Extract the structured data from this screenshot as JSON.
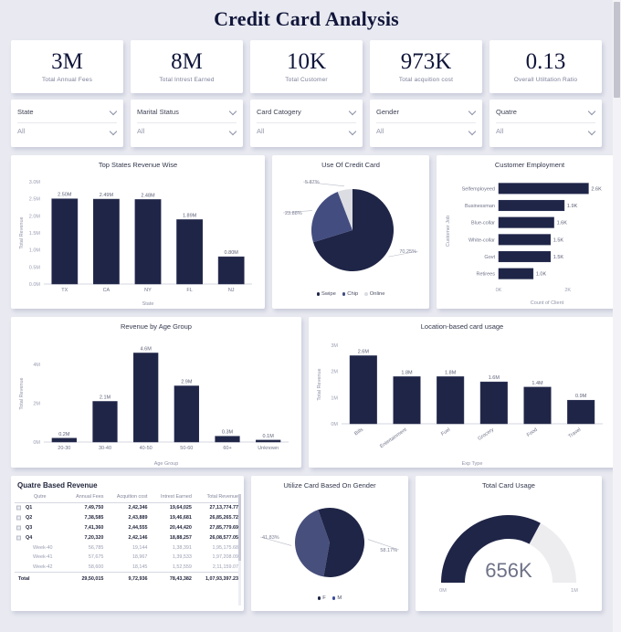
{
  "title": "Credit Card Analysis",
  "colors": {
    "navy": "#1f2547",
    "mid_blue": "#434d80",
    "light_grey": "#dcdde2",
    "page_bg": "#e9eaf1",
    "card_bg": "#ffffff"
  },
  "kpis": [
    {
      "value": "3M",
      "label": "Total Annual Fees"
    },
    {
      "value": "8M",
      "label": "Total Intrest Earned"
    },
    {
      "value": "10K",
      "label": "Total Customer"
    },
    {
      "value": "973K",
      "label": "Total acquition cost"
    },
    {
      "value": "0.13",
      "label": "Overall Utiltation Ratio"
    }
  ],
  "filters": [
    {
      "name": "State",
      "value": "All"
    },
    {
      "name": "Marital Status",
      "value": "All"
    },
    {
      "name": "Card Catogery",
      "value": "All"
    },
    {
      "name": "Gender",
      "value": "All"
    },
    {
      "name": "Quatre",
      "value": "All"
    }
  ],
  "chart_data": [
    {
      "type": "bar",
      "title": "Top States Revenue Wise",
      "xlabel": "State",
      "ylabel": "Total Revenue",
      "categories": [
        "TX",
        "CA",
        "NY",
        "FL",
        "NJ"
      ],
      "values": [
        2.5,
        2.49,
        2.48,
        1.89,
        0.8
      ],
      "labels": [
        "2.50M",
        "2.49M",
        "2.48M",
        "1.89M",
        "0.80M"
      ],
      "yticks": [
        "0.0M",
        "0.5M",
        "1.0M",
        "1.5M",
        "2.0M",
        "2.5M",
        "3.0M"
      ],
      "ylim": [
        0,
        3.0
      ],
      "grid": false
    },
    {
      "type": "pie",
      "title": "Use Of Credit Card",
      "categories": [
        "Swipe",
        "Chip",
        "Online"
      ],
      "values": [
        70.25,
        23.88,
        5.87
      ],
      "labels": [
        "70.25%",
        "23.88%",
        "5.87%"
      ],
      "colors": [
        "#1f2547",
        "#434d80",
        "#dcdde2"
      ],
      "legend": "bottom"
    },
    {
      "type": "bar",
      "orientation": "horizontal",
      "title": "Customer Employment",
      "xlabel": "Count of Client",
      "ylabel": "Customer Job",
      "categories": [
        "Selfemployeed",
        "Businessman",
        "Blue-collar",
        "White-collar",
        "Govt",
        "Retirees"
      ],
      "values": [
        2.6,
        1.9,
        1.6,
        1.5,
        1.5,
        1.0
      ],
      "labels": [
        "2.6K",
        "1.9K",
        "1.6K",
        "1.5K",
        "1.5K",
        "1.0K"
      ],
      "xticks": [
        "0K",
        "2K"
      ],
      "xlim": [
        0,
        2.8
      ],
      "grid": false
    },
    {
      "type": "bar",
      "title": "Revenue by Age Group",
      "xlabel": "Age Group",
      "ylabel": "Total Revenue",
      "categories": [
        "20-30",
        "30-40",
        "40-50",
        "50-60",
        "60+",
        "Unknown"
      ],
      "values": [
        0.2,
        2.1,
        4.6,
        2.9,
        0.3,
        0.1
      ],
      "labels": [
        "0.2M",
        "2.1M",
        "4.6M",
        "2.9M",
        "0.3M",
        "0.1M"
      ],
      "yticks": [
        "0M",
        "2M",
        "4M"
      ],
      "ylim": [
        0,
        5.0
      ],
      "grid": false
    },
    {
      "type": "bar",
      "title": "Location-based card usage",
      "xlabel": "Exp Type",
      "ylabel": "Total Revenue",
      "categories": [
        "Bills",
        "Entertainment",
        "Fuel",
        "Grocery",
        "Food",
        "Travel"
      ],
      "values": [
        2.6,
        1.8,
        1.8,
        1.6,
        1.4,
        0.9
      ],
      "labels": [
        "2.6M",
        "1.8M",
        "1.8M",
        "1.6M",
        "1.4M",
        "0.9M"
      ],
      "yticks": [
        "0M",
        "1M",
        "2M",
        "3M"
      ],
      "ylim": [
        0,
        3.0
      ],
      "grid": false
    },
    {
      "type": "pie",
      "title": "Utilize Card Based On Gender",
      "categories": [
        "F",
        "M"
      ],
      "values": [
        41.83,
        58.17
      ],
      "labels": [
        "41.83%",
        "58.17%"
      ],
      "colors": [
        "#474f7d",
        "#1f2547"
      ],
      "legend": "bottom"
    },
    {
      "type": "gauge",
      "title": "Total Card Usage",
      "value": 656000,
      "value_label": "656K",
      "min_label": "0M",
      "max_label": "1M",
      "ylim": [
        0,
        1000000
      ]
    }
  ],
  "table": {
    "title": "Quatre Based Revenue",
    "columns": [
      "Qutre",
      "Annual Fees",
      "Acquition cost",
      "Intrest Earned",
      "Total Revenue"
    ],
    "rows": [
      {
        "kind": "q",
        "cells": [
          "Q1",
          "7,49,750",
          "2,42,346",
          "19,64,025",
          "27,13,774.77"
        ]
      },
      {
        "kind": "q",
        "cells": [
          "Q2",
          "7,38,585",
          "2,43,889",
          "19,46,681",
          "26,85,265.72"
        ]
      },
      {
        "kind": "q",
        "cells": [
          "Q3",
          "7,41,360",
          "2,44,555",
          "20,44,420",
          "27,85,779.69"
        ]
      },
      {
        "kind": "q",
        "cells": [
          "Q4",
          "7,20,320",
          "2,42,146",
          "18,88,257",
          "26,08,577.05"
        ]
      },
      {
        "kind": "w",
        "cells": [
          "Week-40",
          "56,785",
          "19,144",
          "1,38,391",
          "1,95,175.68"
        ]
      },
      {
        "kind": "w",
        "cells": [
          "Week-41",
          "57,675",
          "18,967",
          "1,39,533",
          "1,97,208.09"
        ]
      },
      {
        "kind": "w",
        "cells": [
          "Week-42",
          "58,600",
          "18,145",
          "1,52,559",
          "2,11,159.07"
        ]
      },
      {
        "kind": "total",
        "cells": [
          "Total",
          "29,50,015",
          "9,72,936",
          "78,43,382",
          "1,07,93,397.23"
        ]
      }
    ]
  }
}
